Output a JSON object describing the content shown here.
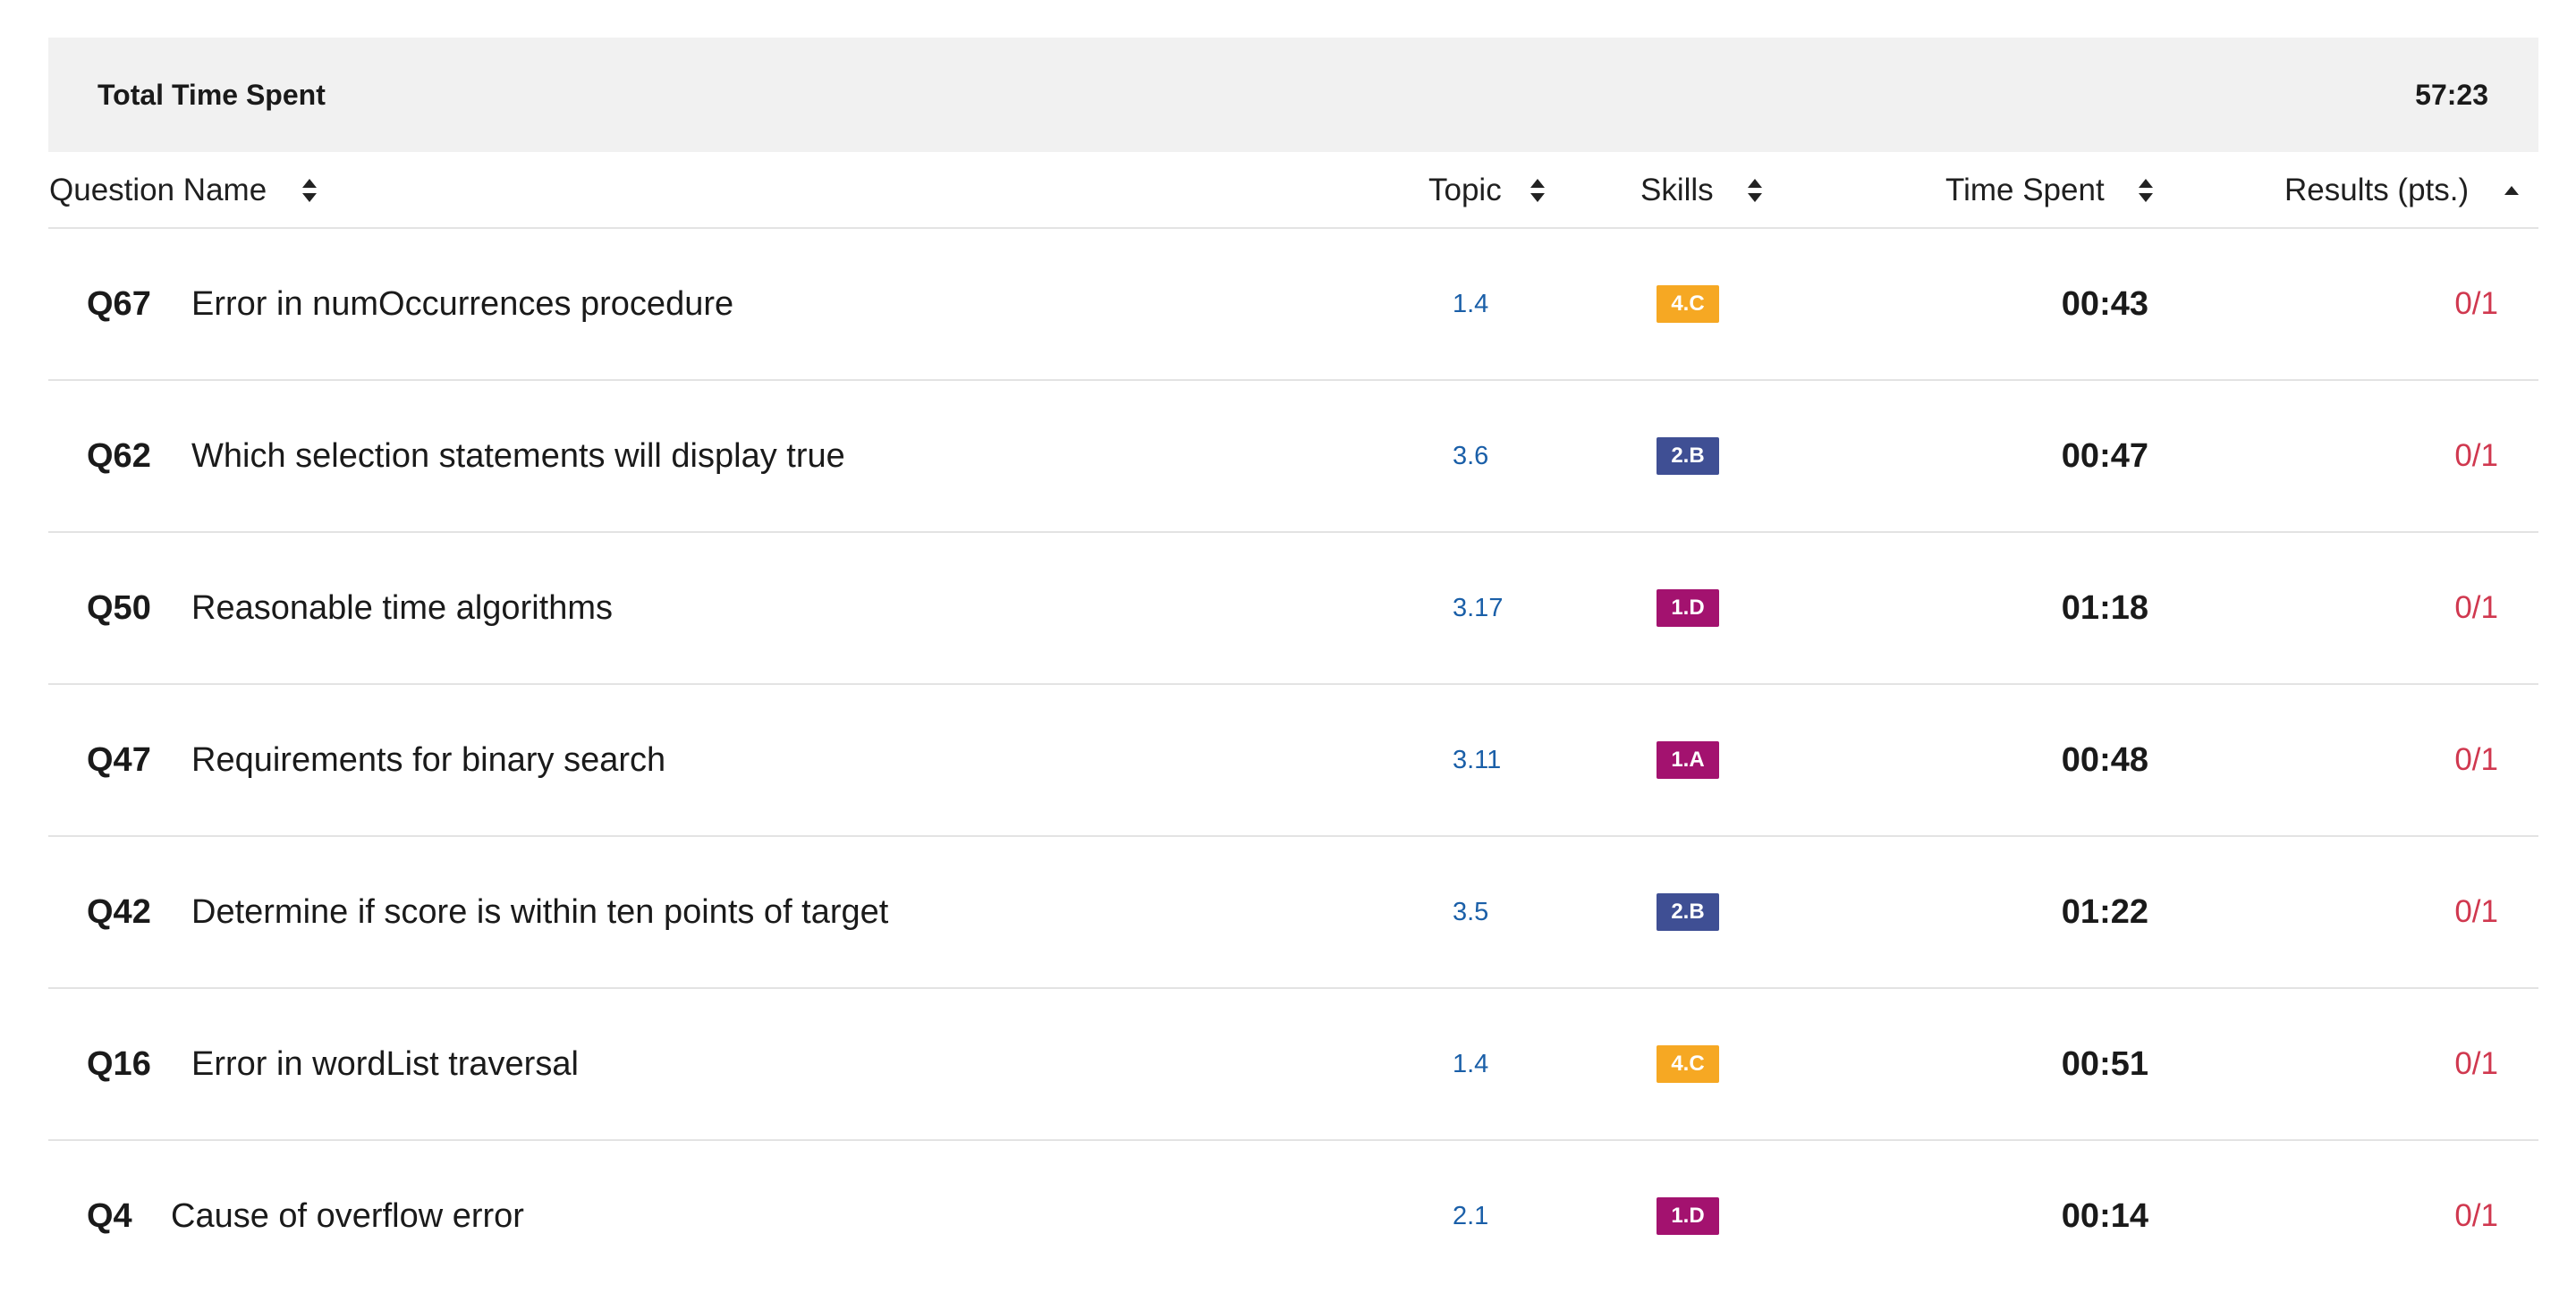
{
  "summary": {
    "label": "Total Time Spent",
    "value": "57:23"
  },
  "columns": {
    "question_name": "Question Name",
    "topic": "Topic",
    "skills": "Skills",
    "time_spent": "Time Spent",
    "results": "Results (pts.)"
  },
  "sort_icons": {
    "question_name": "sort-both-icon",
    "topic": "sort-both-icon",
    "skills": "sort-both-icon",
    "time_spent": "sort-both-icon",
    "results": "sort-ascending-icon"
  },
  "skill_colors": {
    "4.C": "#f6a823",
    "2.B": "#3f4f94",
    "1.D": "#a3126f",
    "1.A": "#a3126f"
  },
  "rows": [
    {
      "id": "Q67",
      "title": "Error in numOccurrences procedure",
      "topic": "1.4",
      "skill": "4.C",
      "time": "00:43",
      "result": "0/1"
    },
    {
      "id": "Q62",
      "title": "Which selection statements will display true",
      "topic": "3.6",
      "skill": "2.B",
      "time": "00:47",
      "result": "0/1"
    },
    {
      "id": "Q50",
      "title": "Reasonable time algorithms",
      "topic": "3.17",
      "skill": "1.D",
      "time": "01:18",
      "result": "0/1"
    },
    {
      "id": "Q47",
      "title": "Requirements for binary search",
      "topic": "3.11",
      "skill": "1.A",
      "time": "00:48",
      "result": "0/1"
    },
    {
      "id": "Q42",
      "title": "Determine if score is within ten points of target",
      "topic": "3.5",
      "skill": "2.B",
      "time": "01:22",
      "result": "0/1"
    },
    {
      "id": "Q16",
      "title": "Error in wordList traversal",
      "topic": "1.4",
      "skill": "4.C",
      "time": "00:51",
      "result": "0/1"
    },
    {
      "id": "Q4",
      "title": "Cause of overflow error",
      "topic": "2.1",
      "skill": "1.D",
      "time": "00:14",
      "result": "0/1"
    }
  ]
}
